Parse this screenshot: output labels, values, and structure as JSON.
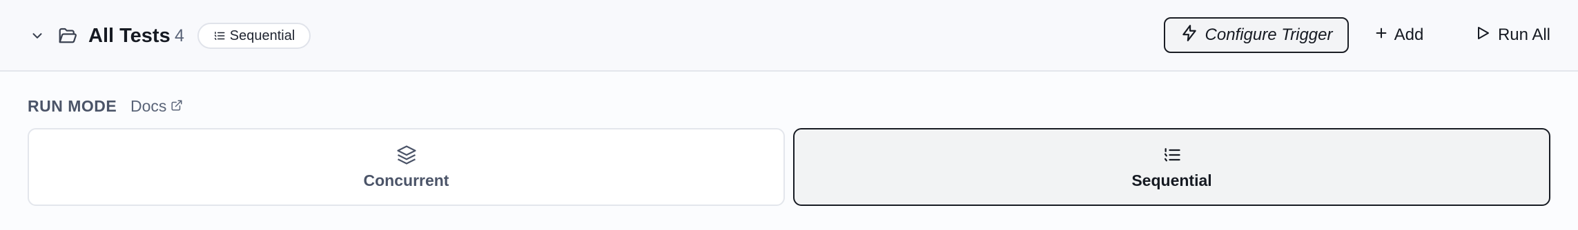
{
  "header": {
    "title": "All Tests",
    "count": "4",
    "mode_badge": "Sequential",
    "buttons": {
      "configure_trigger": "Configure Trigger",
      "add": "Add",
      "run_all": "Run All"
    },
    "icons": {
      "collapse": "chevron-down-icon",
      "folder": "folder-open-icon",
      "badge": "list-ordered-icon",
      "trigger": "lightning-icon",
      "add": "plus-icon",
      "run": "play-icon"
    }
  },
  "run_mode": {
    "label": "RUN MODE",
    "docs_label": "Docs",
    "docs_icon": "external-link-icon",
    "selected": "Sequential",
    "options": [
      {
        "label": "Concurrent",
        "icon": "layers-icon",
        "selected": false
      },
      {
        "label": "Sequential",
        "icon": "list-ordered-icon",
        "selected": true
      }
    ]
  },
  "colors": {
    "header_bg": "#f8f9fc",
    "page_bg": "#fbfcfe",
    "text_primary": "#161a22",
    "text_muted": "#4b5468",
    "border": "#e3e6ec",
    "selected_border": "#161a22",
    "selected_bg": "#f2f3f4"
  }
}
